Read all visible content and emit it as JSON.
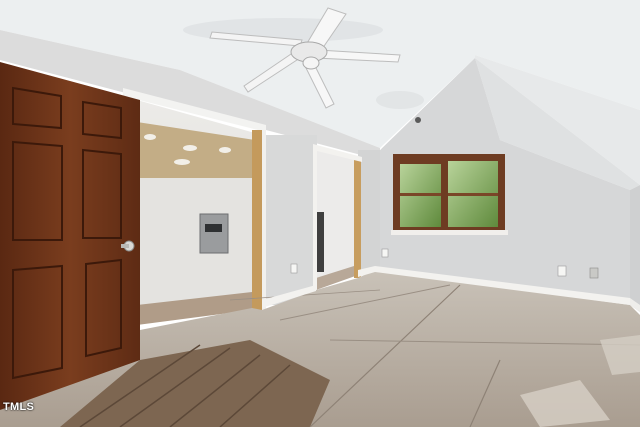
{
  "photo": {
    "watermark": "TMLS"
  },
  "colors": {
    "ceiling": "#eef0f1",
    "wall": "#dcdcdc",
    "floor": "#b1a69a",
    "door_wood": "#6b3319",
    "trim": "#f4f4f2",
    "window_frame": "#6e3c22",
    "foliage": "#7ea05a"
  }
}
